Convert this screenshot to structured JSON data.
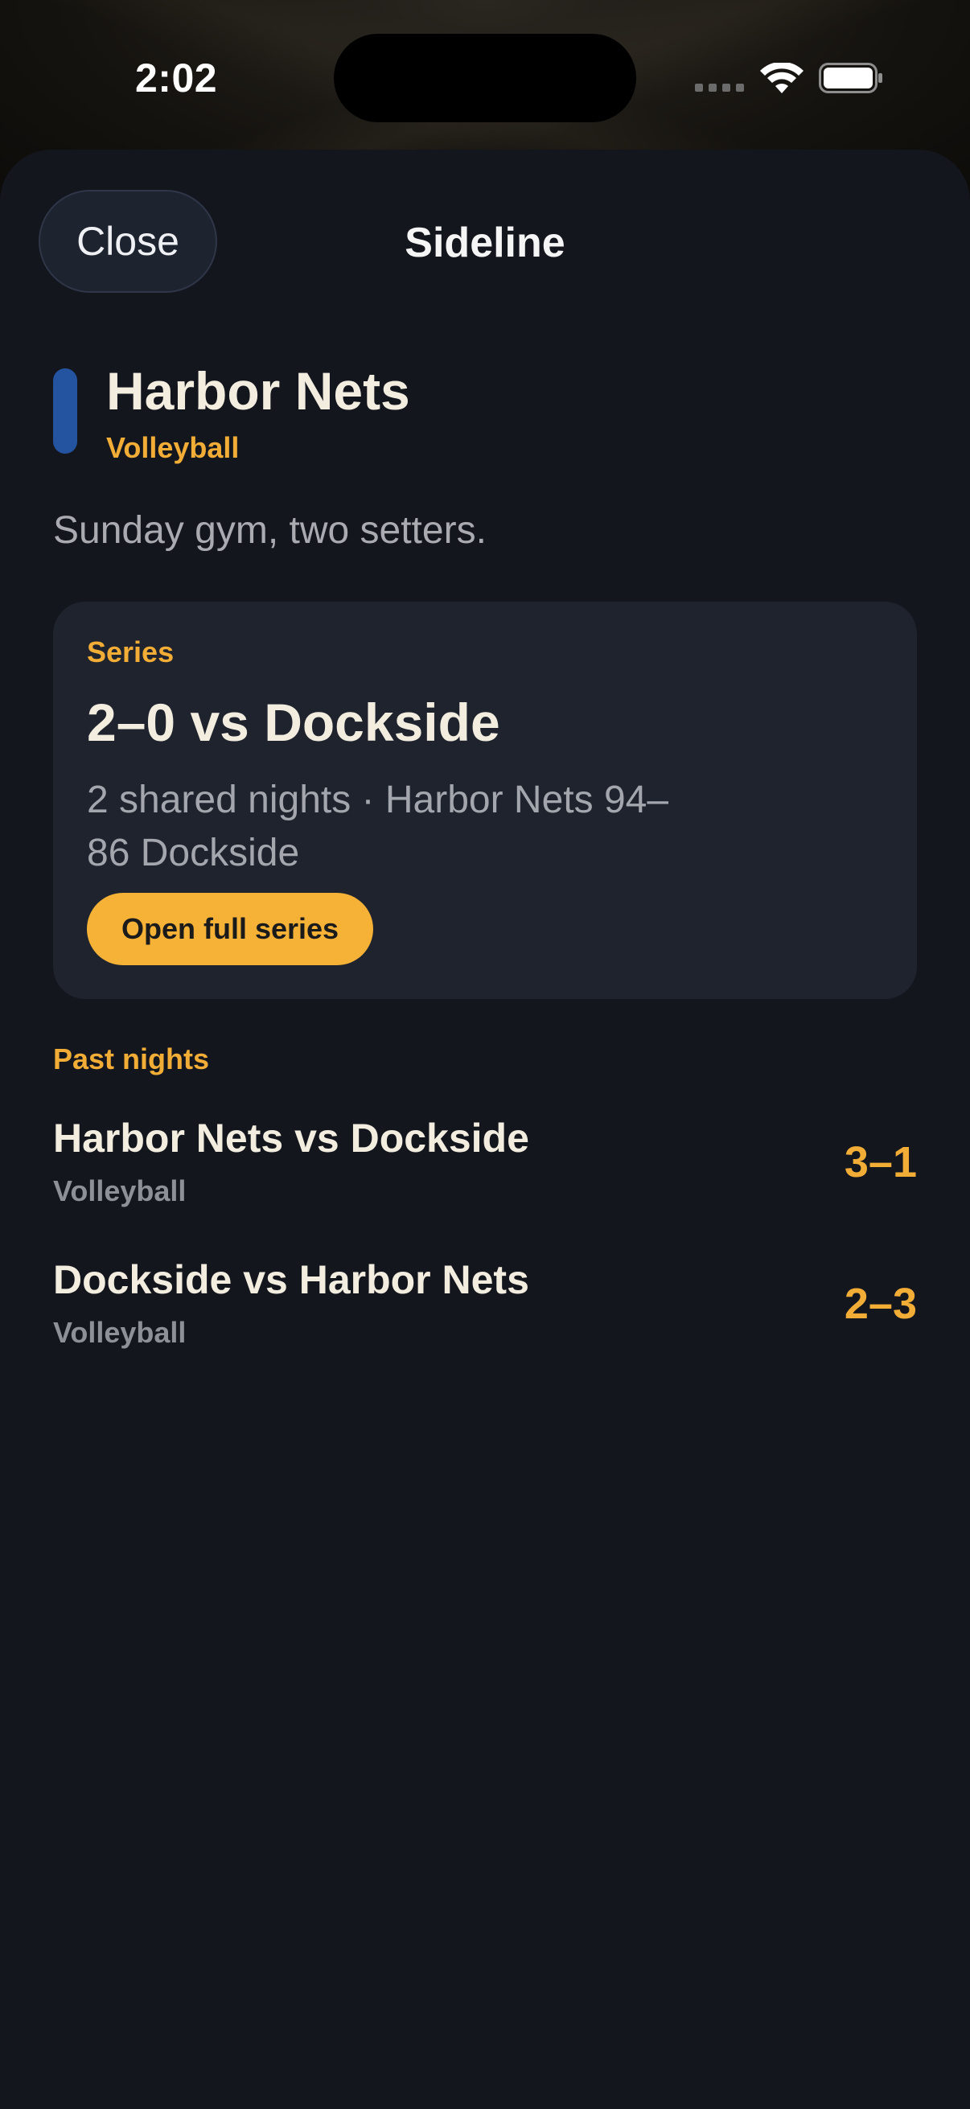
{
  "status_bar": {
    "time": "2:02"
  },
  "sheet": {
    "close_label": "Close",
    "title": "Sideline"
  },
  "team": {
    "name": "Harbor Nets",
    "sport": "Volleyball",
    "description": "Sunday gym, two setters.",
    "accent_color": "#2454a0"
  },
  "series": {
    "eyebrow": "Series",
    "headline": "2–0 vs Dockside",
    "detail": "2 shared nights · Harbor Nets 94–86 Dockside",
    "button_label": "Open full series"
  },
  "past_nights": {
    "label": "Past nights",
    "items": [
      {
        "title": "Harbor Nets vs Dockside",
        "sport": "Volleyball",
        "score": "3–1"
      },
      {
        "title": "Dockside vs Harbor Nets",
        "sport": "Volleyball",
        "score": "2–3"
      }
    ]
  },
  "colors": {
    "accent": "#f2ad36",
    "background": "#14161e",
    "card": "#1e232e"
  }
}
